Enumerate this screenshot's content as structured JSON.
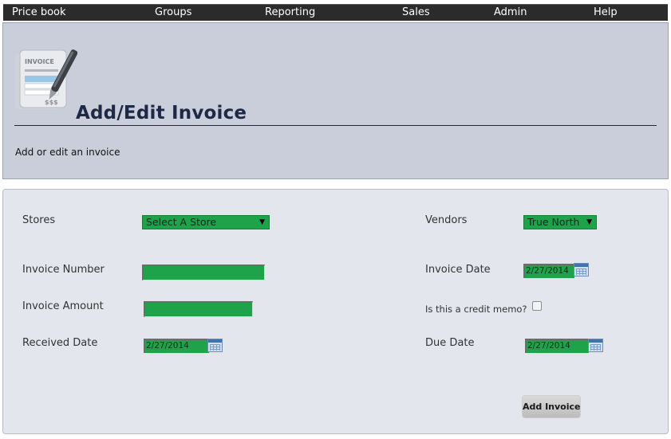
{
  "nav": {
    "items": [
      "Price book",
      "Groups",
      "Reporting",
      "Sales",
      "Admin",
      "Help"
    ]
  },
  "header": {
    "title": "Add/Edit Invoice",
    "subtitle": "Add or edit an invoice",
    "logo_text": "INVOICE",
    "logo_price": "$$$",
    "logo_icon": "invoice-pen-icon"
  },
  "form": {
    "stores_label": "Stores",
    "stores_value": "Select A Store",
    "vendors_label": "Vendors",
    "vendors_value": "True North",
    "invoice_number_label": "Invoice Number",
    "invoice_number_value": "",
    "invoice_date_label": "Invoice Date",
    "invoice_date_value": "2/27/2014",
    "invoice_amount_label": "Invoice Amount",
    "invoice_amount_value": "",
    "credit_memo_label": "Is this a credit memo?",
    "credit_memo_checked": false,
    "received_date_label": "Received Date",
    "received_date_value": "2/27/2014",
    "due_date_label": "Due Date",
    "due_date_value": "2/27/2014",
    "submit_label": "Add Invoice"
  },
  "colors": {
    "nav_bg": "#2b2b2b",
    "header_bg": "#c9ceda",
    "title_color": "#1e2a45",
    "form_bg": "#e4e6ed",
    "field_green": "#1fa34a"
  }
}
